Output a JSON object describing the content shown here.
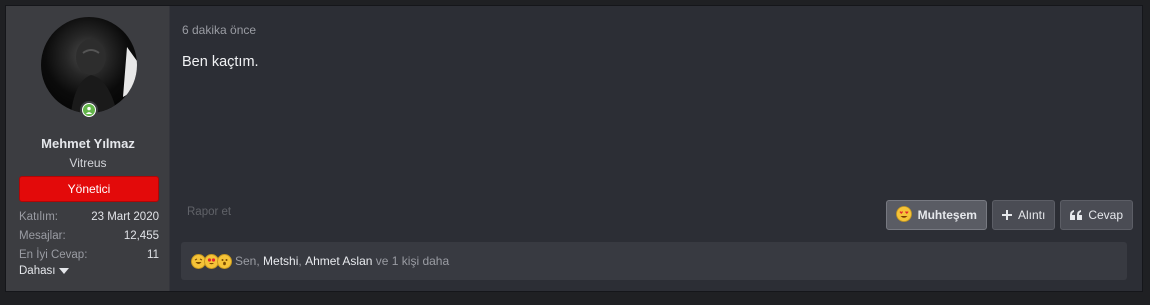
{
  "user": {
    "name": "Mehmet Yılmaz",
    "title": "Vitreus",
    "role_badge": "Yönetici",
    "stats": [
      {
        "label": "Katılım:",
        "value": "23 Mart 2020"
      },
      {
        "label": "Mesajlar:",
        "value": "12,455"
      },
      {
        "label": "En İyi Cevap:",
        "value": "11"
      }
    ],
    "more_label": "Dahası"
  },
  "post": {
    "timestamp": "6 dakika önce",
    "message": "Ben kaçtım.",
    "report_label": "Rapor et"
  },
  "actions": {
    "reaction_label": "Muhteşem",
    "quote_label": "Alıntı",
    "reply_label": "Cevap"
  },
  "reactions": {
    "prefix": "Sen,",
    "name_1": "Metshi",
    "separator": ",",
    "name_2": "Ahmet Aslan",
    "suffix": "ve 1 kişi daha",
    "icons": [
      "rofl-emoji-icon",
      "heart-eyes-emoji-icon",
      "wow-emoji-icon"
    ]
  },
  "colors": {
    "role_badge": "#e30a0a",
    "online": "#63b54a",
    "reaction_emoji": "#f5c338"
  }
}
